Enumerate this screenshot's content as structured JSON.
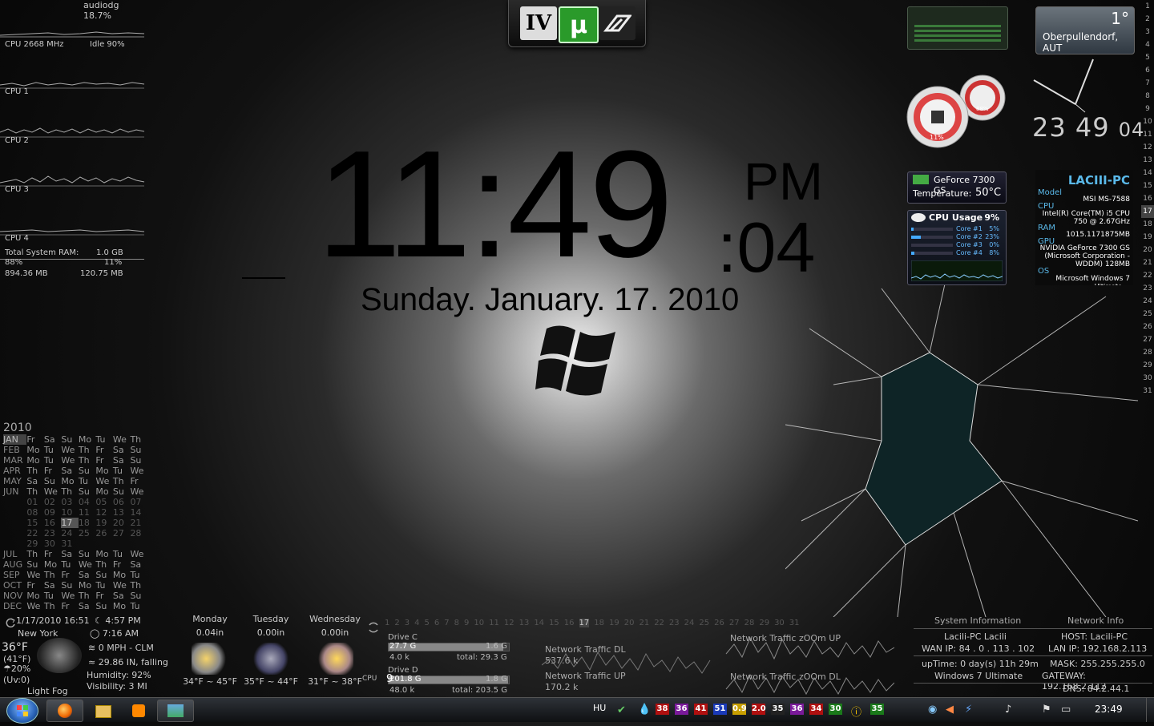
{
  "cpu_meters": {
    "process": "audiodg 18.7%",
    "cpu_mhz": "CPU 2668 MHz",
    "idle": "Idle 90%",
    "cores": [
      "CPU 1",
      "CPU 2",
      "CPU 3",
      "CPU 4"
    ],
    "ram_label": "Total System RAM:",
    "ram_total": "1.0 GB",
    "ram_used_pct": "88%",
    "ram_free_pct": "11%",
    "ram_used": "894.36 MB",
    "ram_free": "120.75 MB"
  },
  "launcher": {
    "items": [
      "IV",
      "µ",
      "NFS"
    ]
  },
  "clock": {
    "hm": "11:49",
    "ampm": "PM",
    "sec": ":04",
    "date": "Sunday. January. 17. 2010"
  },
  "weather_top": {
    "temp": "1°",
    "location": "Oberpullendorf, AUT"
  },
  "digital_clock": {
    "h": "23",
    "m": "49",
    "s": "04"
  },
  "gauges": {
    "cpu": "11%",
    "mem": "88%"
  },
  "gpu": {
    "name": "GeForce 7300 GS",
    "temp_label": "Temperature:",
    "temp": "50°C"
  },
  "cpu_usage": {
    "title": "CPU Usage",
    "total": "9%",
    "cores": [
      {
        "name": "Core #1",
        "value": "5%",
        "fraction": 0.05
      },
      {
        "name": "Core #2",
        "value": "23%",
        "fraction": 0.23
      },
      {
        "name": "Core #3",
        "value": "0%",
        "fraction": 0.0
      },
      {
        "name": "Core #4",
        "value": "8%",
        "fraction": 0.08
      }
    ]
  },
  "pc_info": {
    "name": "LACIII-PC",
    "model_k": "Model",
    "model": "MSI MS-7588",
    "cpu_k": "CPU",
    "cpu": "Intel(R) Core(TM) i5 CPU 750 @ 2.67GHz",
    "ram_k": "RAM",
    "ram": "1015.1171875MB",
    "gpu_k": "GPU",
    "gpu": "NVIDIA GeForce 7300 GS (Microsoft Corporation - WDDM) 128MB",
    "os_k": "OS",
    "os": "Microsoft Windows 7",
    "os_ed": "Ultimate"
  },
  "day_ruler": [
    "1",
    "2",
    "3",
    "4",
    "5",
    "6",
    "7",
    "8",
    "9",
    "10",
    "11",
    "12",
    "13",
    "14",
    "15",
    "16",
    "17",
    "18",
    "19",
    "20",
    "21",
    "22",
    "23",
    "24",
    "25",
    "26",
    "27",
    "28",
    "29",
    "30",
    "31"
  ],
  "day_ruler_current": "17",
  "calendar": {
    "year": "2010",
    "month_rows": [
      {
        "m": "JAN",
        "d": [
          "Fr",
          "Sa",
          "Su",
          "Mo",
          "Tu",
          "We",
          "Th"
        ]
      },
      {
        "m": "FEB",
        "d": [
          "Mo",
          "Tu",
          "We",
          "Th",
          "Fr",
          "Sa",
          "Su"
        ]
      },
      {
        "m": "MAR",
        "d": [
          "Mo",
          "Tu",
          "We",
          "Th",
          "Fr",
          "Sa",
          "Su"
        ]
      },
      {
        "m": "APR",
        "d": [
          "Th",
          "Fr",
          "Sa",
          "Su",
          "Mo",
          "Tu",
          "We"
        ]
      },
      {
        "m": "MAY",
        "d": [
          "Sa",
          "Su",
          "Mo",
          "Tu",
          "We",
          "Th",
          "Fr"
        ]
      },
      {
        "m": "JUN",
        "d": [
          "Th",
          "We",
          "Th",
          "Su",
          "Mo",
          "Su",
          "We"
        ]
      }
    ],
    "day_rows": [
      [
        "01",
        "02",
        "03",
        "04",
        "05",
        "06",
        "07"
      ],
      [
        "08",
        "09",
        "10",
        "11",
        "12",
        "13",
        "14"
      ],
      [
        "15",
        "16",
        "17",
        "18",
        "19",
        "20",
        "21"
      ],
      [
        "22",
        "23",
        "24",
        "25",
        "26",
        "27",
        "28"
      ],
      [
        "29",
        "30",
        "31",
        "",
        "",
        "",
        ""
      ]
    ],
    "month_rows_2": [
      {
        "m": "JUL",
        "d": [
          "Th",
          "Fr",
          "Sa",
          "Su",
          "Mo",
          "Tu",
          "We"
        ]
      },
      {
        "m": "AUG",
        "d": [
          "Su",
          "Mo",
          "Tu",
          "We",
          "Th",
          "Fr",
          "Sa"
        ]
      },
      {
        "m": "SEP",
        "d": [
          "We",
          "Th",
          "Fr",
          "Sa",
          "Su",
          "Mo",
          "Tu"
        ]
      },
      {
        "m": "OCT",
        "d": [
          "Fr",
          "Sa",
          "Su",
          "Mo",
          "Tu",
          "We",
          "Th"
        ]
      },
      {
        "m": "NOV",
        "d": [
          "Mo",
          "Tu",
          "We",
          "Th",
          "Fr",
          "Sa",
          "Su"
        ]
      },
      {
        "m": "DEC",
        "d": [
          "We",
          "Th",
          "Fr",
          "Sa",
          "Su",
          "Mo",
          "Tu"
        ]
      }
    ]
  },
  "bottom_weather": {
    "datetime": "1/17/2010 16:51",
    "sunset": "4:57 PM",
    "city": "New York",
    "sunrise": "7:16 AM",
    "temp": "36°F",
    "temp_c": "(41°F)",
    "precip": "20%",
    "uv": "(Uv:0)",
    "condition": "Light Fog",
    "wind": "0 MPH - CLM",
    "pressure": "29.86 IN, falling",
    "humidity": "Humidity: 92%",
    "visibility": "Visibility: 3 MI",
    "forecast": [
      {
        "day": "Monday",
        "rain": "0.04in",
        "range": "34°F ~ 45°F"
      },
      {
        "day": "Tuesday",
        "rain": "0.00in",
        "range": "35°F ~ 44°F"
      },
      {
        "day": "Wednesday",
        "rain": "0.00in",
        "range": "31°F ~ 38°F"
      }
    ]
  },
  "drives": {
    "cpu_label": "CPU",
    "cpu_val": "9",
    "c": {
      "label": "Drive C",
      "used": "27.7 G",
      "free": "1.6 G",
      "rate": "4.0 k",
      "total": "total: 29.3 G",
      "fraction": 0.95
    },
    "d": {
      "label": "Drive D",
      "used": "201.8 G",
      "free": "1.8 G",
      "rate": "48.0 k",
      "total": "total: 203.5 G",
      "fraction": 0.99
    }
  },
  "network": {
    "dl_label": "Network Traffic DL",
    "dl_val": "537.6 k",
    "ul_label": "Network Traffic UP",
    "ul_val": "170.2 k",
    "zoom_up": "Network Traffic zOOm UP",
    "zoom_dl": "Network Traffic zOOm DL"
  },
  "sys_info": {
    "title": "System Information",
    "net_title": "Network Info",
    "user": "Lacili-PC  Lacili",
    "host": "HOST: Lacili-PC",
    "wan": "WAN IP: 84 . 0 . 113 . 102",
    "lan": "LAN IP: 192.168.2.113",
    "uptime": "upTime: 0 day(s) 11h 29m",
    "mask": "MASK: 255.255.255.0",
    "os": "Windows 7 Ultimate",
    "gateway": "GATEWAY: 192.168.2.112",
    "dns": "DNS: 84.2.44.1"
  },
  "taskbar": {
    "lang": "HU",
    "clock": "23:49",
    "badges": [
      {
        "t": "38",
        "c": "#b01010"
      },
      {
        "t": "36",
        "c": "#7a1a9a"
      },
      {
        "t": "41",
        "c": "#b01010"
      },
      {
        "t": "51",
        "c": "#1a3ab8"
      },
      {
        "t": "0.9",
        "c": "#c8a000"
      },
      {
        "t": "2.0",
        "c": "#b01010"
      },
      {
        "t": "35",
        "c": "#222222"
      },
      {
        "t": "36",
        "c": "#7a1a9a"
      },
      {
        "t": "34",
        "c": "#b01010"
      },
      {
        "t": "30",
        "c": "#1a7a1a"
      },
      {
        "t": "35",
        "c": "#1a7a1a"
      }
    ]
  },
  "digits_strip": [
    "1",
    "2",
    "3",
    "4",
    "5",
    "6",
    "7",
    "8",
    "9",
    "10",
    "11",
    "12",
    "13",
    "14",
    "15",
    "16",
    "17",
    "18",
    "19",
    "20",
    "21",
    "22",
    "23",
    "24",
    "25",
    "26",
    "27",
    "28",
    "29",
    "30",
    "31"
  ]
}
